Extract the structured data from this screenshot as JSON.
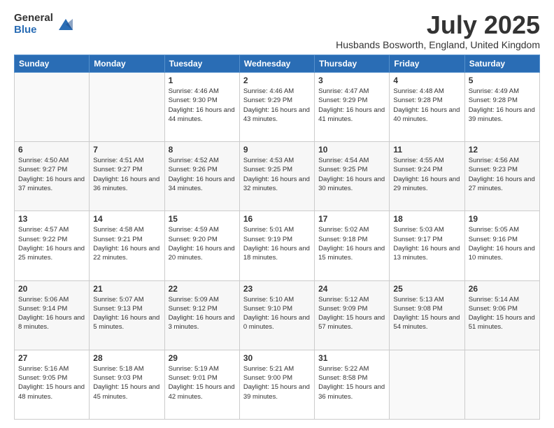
{
  "header": {
    "logo_general": "General",
    "logo_blue": "Blue",
    "month_title": "July 2025",
    "location": "Husbands Bosworth, England, United Kingdom"
  },
  "days_of_week": [
    "Sunday",
    "Monday",
    "Tuesday",
    "Wednesday",
    "Thursday",
    "Friday",
    "Saturday"
  ],
  "weeks": [
    [
      {
        "day": "",
        "sunrise": "",
        "sunset": "",
        "daylight": ""
      },
      {
        "day": "",
        "sunrise": "",
        "sunset": "",
        "daylight": ""
      },
      {
        "day": "1",
        "sunrise": "Sunrise: 4:46 AM",
        "sunset": "Sunset: 9:30 PM",
        "daylight": "Daylight: 16 hours and 44 minutes."
      },
      {
        "day": "2",
        "sunrise": "Sunrise: 4:46 AM",
        "sunset": "Sunset: 9:29 PM",
        "daylight": "Daylight: 16 hours and 43 minutes."
      },
      {
        "day": "3",
        "sunrise": "Sunrise: 4:47 AM",
        "sunset": "Sunset: 9:29 PM",
        "daylight": "Daylight: 16 hours and 41 minutes."
      },
      {
        "day": "4",
        "sunrise": "Sunrise: 4:48 AM",
        "sunset": "Sunset: 9:28 PM",
        "daylight": "Daylight: 16 hours and 40 minutes."
      },
      {
        "day": "5",
        "sunrise": "Sunrise: 4:49 AM",
        "sunset": "Sunset: 9:28 PM",
        "daylight": "Daylight: 16 hours and 39 minutes."
      }
    ],
    [
      {
        "day": "6",
        "sunrise": "Sunrise: 4:50 AM",
        "sunset": "Sunset: 9:27 PM",
        "daylight": "Daylight: 16 hours and 37 minutes."
      },
      {
        "day": "7",
        "sunrise": "Sunrise: 4:51 AM",
        "sunset": "Sunset: 9:27 PM",
        "daylight": "Daylight: 16 hours and 36 minutes."
      },
      {
        "day": "8",
        "sunrise": "Sunrise: 4:52 AM",
        "sunset": "Sunset: 9:26 PM",
        "daylight": "Daylight: 16 hours and 34 minutes."
      },
      {
        "day": "9",
        "sunrise": "Sunrise: 4:53 AM",
        "sunset": "Sunset: 9:25 PM",
        "daylight": "Daylight: 16 hours and 32 minutes."
      },
      {
        "day": "10",
        "sunrise": "Sunrise: 4:54 AM",
        "sunset": "Sunset: 9:25 PM",
        "daylight": "Daylight: 16 hours and 30 minutes."
      },
      {
        "day": "11",
        "sunrise": "Sunrise: 4:55 AM",
        "sunset": "Sunset: 9:24 PM",
        "daylight": "Daylight: 16 hours and 29 minutes."
      },
      {
        "day": "12",
        "sunrise": "Sunrise: 4:56 AM",
        "sunset": "Sunset: 9:23 PM",
        "daylight": "Daylight: 16 hours and 27 minutes."
      }
    ],
    [
      {
        "day": "13",
        "sunrise": "Sunrise: 4:57 AM",
        "sunset": "Sunset: 9:22 PM",
        "daylight": "Daylight: 16 hours and 25 minutes."
      },
      {
        "day": "14",
        "sunrise": "Sunrise: 4:58 AM",
        "sunset": "Sunset: 9:21 PM",
        "daylight": "Daylight: 16 hours and 22 minutes."
      },
      {
        "day": "15",
        "sunrise": "Sunrise: 4:59 AM",
        "sunset": "Sunset: 9:20 PM",
        "daylight": "Daylight: 16 hours and 20 minutes."
      },
      {
        "day": "16",
        "sunrise": "Sunrise: 5:01 AM",
        "sunset": "Sunset: 9:19 PM",
        "daylight": "Daylight: 16 hours and 18 minutes."
      },
      {
        "day": "17",
        "sunrise": "Sunrise: 5:02 AM",
        "sunset": "Sunset: 9:18 PM",
        "daylight": "Daylight: 16 hours and 15 minutes."
      },
      {
        "day": "18",
        "sunrise": "Sunrise: 5:03 AM",
        "sunset": "Sunset: 9:17 PM",
        "daylight": "Daylight: 16 hours and 13 minutes."
      },
      {
        "day": "19",
        "sunrise": "Sunrise: 5:05 AM",
        "sunset": "Sunset: 9:16 PM",
        "daylight": "Daylight: 16 hours and 10 minutes."
      }
    ],
    [
      {
        "day": "20",
        "sunrise": "Sunrise: 5:06 AM",
        "sunset": "Sunset: 9:14 PM",
        "daylight": "Daylight: 16 hours and 8 minutes."
      },
      {
        "day": "21",
        "sunrise": "Sunrise: 5:07 AM",
        "sunset": "Sunset: 9:13 PM",
        "daylight": "Daylight: 16 hours and 5 minutes."
      },
      {
        "day": "22",
        "sunrise": "Sunrise: 5:09 AM",
        "sunset": "Sunset: 9:12 PM",
        "daylight": "Daylight: 16 hours and 3 minutes."
      },
      {
        "day": "23",
        "sunrise": "Sunrise: 5:10 AM",
        "sunset": "Sunset: 9:10 PM",
        "daylight": "Daylight: 16 hours and 0 minutes."
      },
      {
        "day": "24",
        "sunrise": "Sunrise: 5:12 AM",
        "sunset": "Sunset: 9:09 PM",
        "daylight": "Daylight: 15 hours and 57 minutes."
      },
      {
        "day": "25",
        "sunrise": "Sunrise: 5:13 AM",
        "sunset": "Sunset: 9:08 PM",
        "daylight": "Daylight: 15 hours and 54 minutes."
      },
      {
        "day": "26",
        "sunrise": "Sunrise: 5:14 AM",
        "sunset": "Sunset: 9:06 PM",
        "daylight": "Daylight: 15 hours and 51 minutes."
      }
    ],
    [
      {
        "day": "27",
        "sunrise": "Sunrise: 5:16 AM",
        "sunset": "Sunset: 9:05 PM",
        "daylight": "Daylight: 15 hours and 48 minutes."
      },
      {
        "day": "28",
        "sunrise": "Sunrise: 5:18 AM",
        "sunset": "Sunset: 9:03 PM",
        "daylight": "Daylight: 15 hours and 45 minutes."
      },
      {
        "day": "29",
        "sunrise": "Sunrise: 5:19 AM",
        "sunset": "Sunset: 9:01 PM",
        "daylight": "Daylight: 15 hours and 42 minutes."
      },
      {
        "day": "30",
        "sunrise": "Sunrise: 5:21 AM",
        "sunset": "Sunset: 9:00 PM",
        "daylight": "Daylight: 15 hours and 39 minutes."
      },
      {
        "day": "31",
        "sunrise": "Sunrise: 5:22 AM",
        "sunset": "Sunset: 8:58 PM",
        "daylight": "Daylight: 15 hours and 36 minutes."
      },
      {
        "day": "",
        "sunrise": "",
        "sunset": "",
        "daylight": ""
      },
      {
        "day": "",
        "sunrise": "",
        "sunset": "",
        "daylight": ""
      }
    ]
  ]
}
